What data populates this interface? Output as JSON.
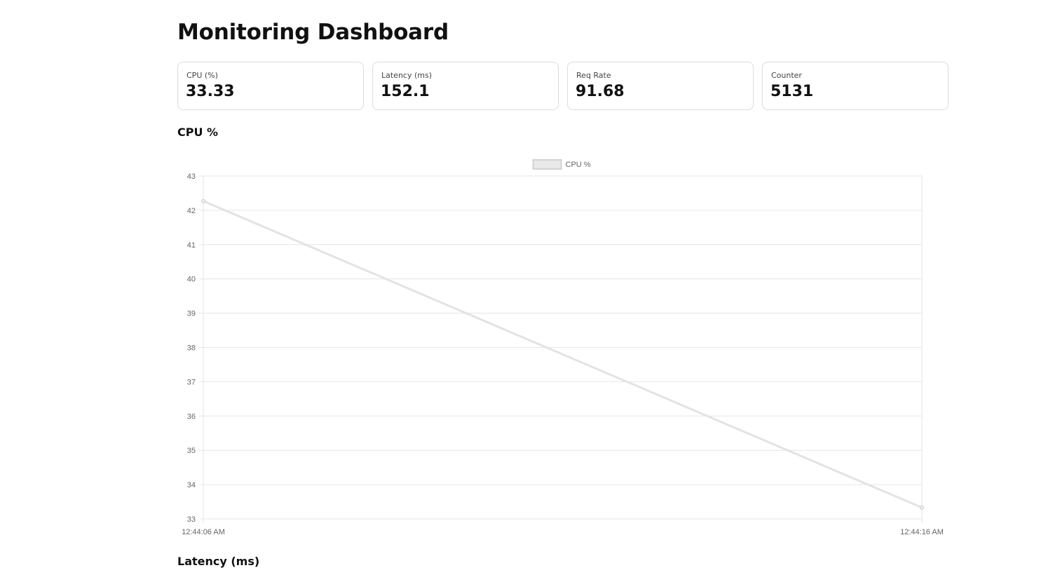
{
  "page": {
    "title": "Monitoring Dashboard"
  },
  "cards": [
    {
      "label": "CPU (%)",
      "value": "33.33"
    },
    {
      "label": "Latency (ms)",
      "value": "152.1"
    },
    {
      "label": "Req Rate",
      "value": "91.68"
    },
    {
      "label": "Counter",
      "value": "5131"
    }
  ],
  "sections": {
    "cpu_title": "CPU %",
    "latency_title": "Latency (ms)"
  },
  "chart_data": {
    "type": "line",
    "x": [
      "12:44:06 AM",
      "12:44:16 AM"
    ],
    "series": [
      {
        "name": "CPU %",
        "values": [
          42.27,
          33.33
        ]
      }
    ],
    "ylim": [
      33,
      43
    ],
    "yticks": [
      "33",
      "34",
      "35",
      "36",
      "37",
      "38",
      "39",
      "40",
      "41",
      "42",
      "43"
    ],
    "grid": true,
    "legend": "top-center",
    "colors": {
      "line": "#e3e3e3",
      "point": "#cccccc",
      "grid": "#e6e6e6",
      "tick_text": "#666666"
    }
  }
}
